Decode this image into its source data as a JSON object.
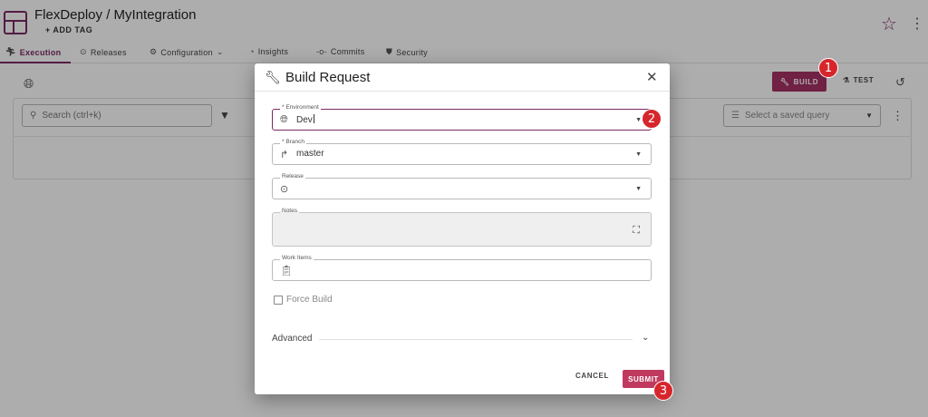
{
  "app": {
    "title": "FlexDeploy / MyIntegration",
    "add_tag": "+ ADD TAG"
  },
  "tabs": [
    {
      "label": "Execution",
      "icon": "runner-icon"
    },
    {
      "label": "Releases",
      "icon": "release-icon"
    },
    {
      "label": "Configuration",
      "icon": "gear-icon"
    },
    {
      "label": "Insights",
      "icon": "insights-icon"
    },
    {
      "label": "Commits",
      "icon": "commit-icon"
    },
    {
      "label": "Security",
      "icon": "shield-icon"
    }
  ],
  "toolbar": {
    "build_label": "BUILD",
    "test_label": "TEST"
  },
  "search": {
    "placeholder": "Search (ctrl+k)",
    "saved_query_placeholder": "Select a saved query"
  },
  "dialog": {
    "title": "Build Request",
    "fields": {
      "environment": {
        "label": "* Environment",
        "value": "Dev"
      },
      "branch": {
        "label": "* Branch",
        "value": "master"
      },
      "release": {
        "label": "Release",
        "value": ""
      },
      "notes": {
        "label": "Notes",
        "value": ""
      },
      "work_items": {
        "label": "Work Items",
        "value": ""
      }
    },
    "force_build_label": "Force Build",
    "advanced_label": "Advanced",
    "cancel_label": "CANCEL",
    "submit_label": "SUBMIT"
  },
  "annotations": {
    "step1": "1",
    "step2": "2",
    "step3": "3"
  },
  "colors": {
    "accent": "#7b2a63",
    "build_button": "#a63265",
    "submit_button": "#c0395f",
    "badge": "#d6262c"
  }
}
